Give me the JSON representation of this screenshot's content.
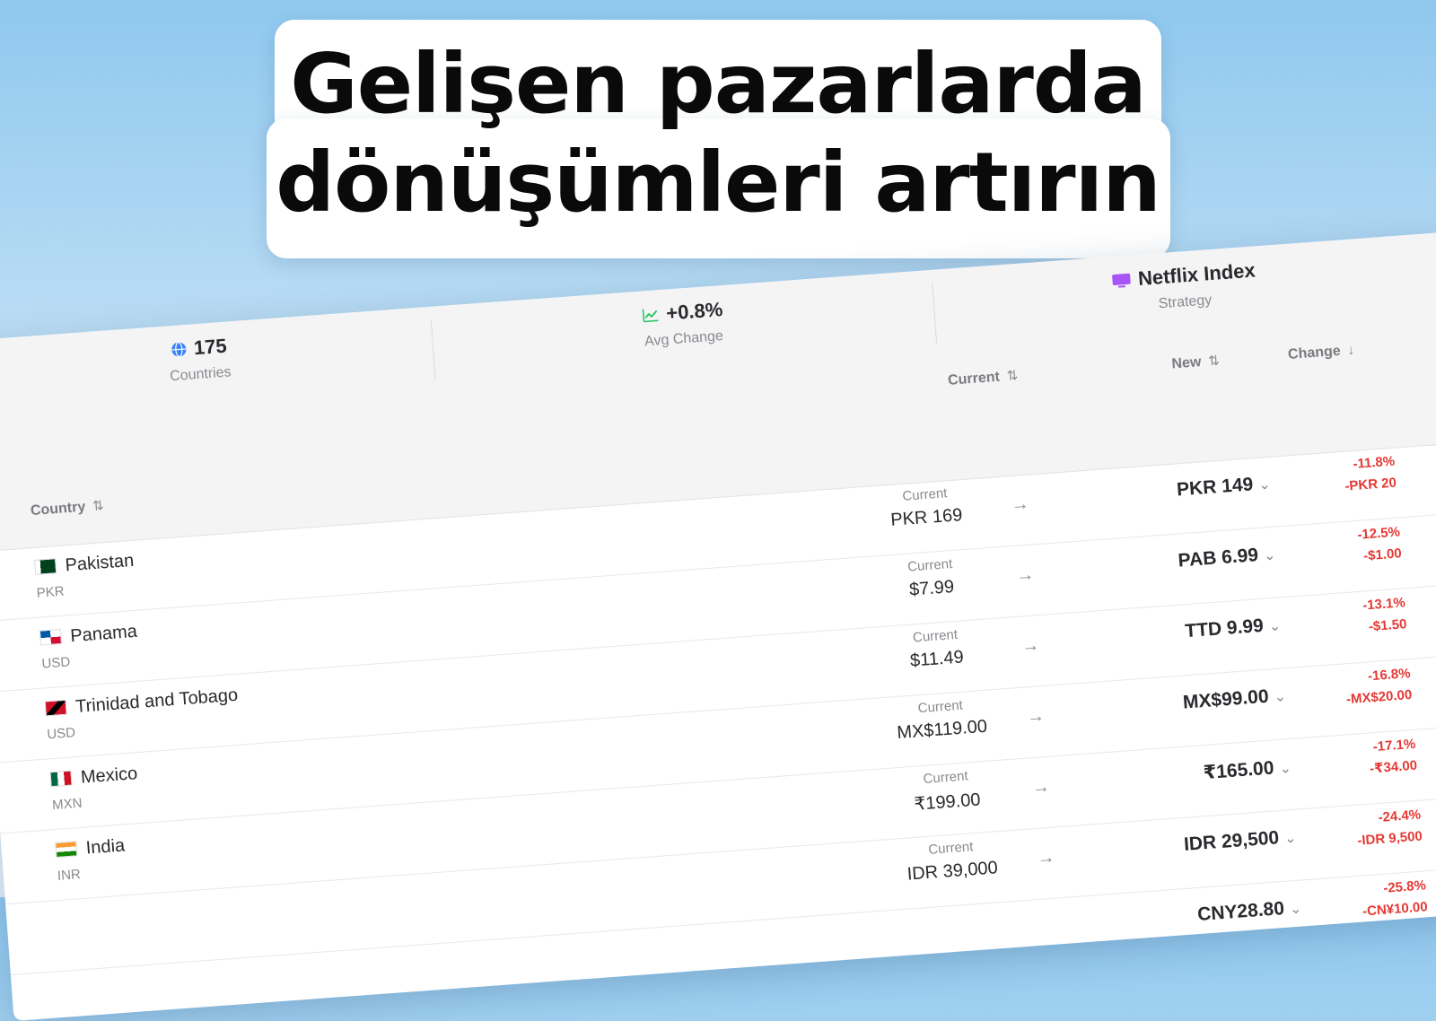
{
  "headline": {
    "line1": "Gelişen pazarlarda",
    "line2": "dönüşümleri artırın"
  },
  "stats": [
    {
      "value": "175",
      "label": "Countries",
      "icon": "globe-icon",
      "icon_color": "#3b82f6"
    },
    {
      "value": "+0.8%",
      "label": "Avg Change",
      "icon": "chart-line-icon",
      "icon_color": "#22c55e"
    },
    {
      "value": "Netflix Index",
      "label": "Strategy",
      "icon": "tv-icon",
      "icon_color": "#a855f7"
    }
  ],
  "columns": {
    "country": "Country",
    "current": "Current",
    "new": "New",
    "change": "Change"
  },
  "row_current_label": "Current",
  "rows": [
    {
      "country": "Pakistan",
      "currency": "PKR",
      "current": "PKR 169",
      "new": "PKR 149",
      "pct": "-11.8%",
      "diff": "-PKR 20"
    },
    {
      "country": "Panama",
      "currency": "USD",
      "current": "$7.99",
      "new": "PAB 6.99",
      "pct": "-12.5%",
      "diff": "-$1.00"
    },
    {
      "country": "Trinidad and Tobago",
      "currency": "USD",
      "current": "$11.49",
      "new": "TTD 9.99",
      "pct": "-13.1%",
      "diff": "-$1.50"
    },
    {
      "country": "Mexico",
      "currency": "MXN",
      "current": "MX$119.00",
      "new": "MX$99.00",
      "pct": "-16.8%",
      "diff": "-MX$20.00"
    },
    {
      "country": "India",
      "currency": "INR",
      "current": "₹199.00",
      "new": "₹165.00",
      "pct": "-17.1%",
      "diff": "-₹34.00"
    },
    {
      "country": "",
      "currency": "",
      "current": "IDR 39,000",
      "new": "IDR 29,500",
      "pct": "-24.4%",
      "diff": "-IDR 9,500"
    },
    {
      "country": "",
      "currency": "",
      "current": "",
      "new": "CNY28.80",
      "pct": "-25.8%",
      "diff": "-CN¥10.00"
    }
  ],
  "colors": {
    "negative": "#e53935",
    "text": "#2a2a2e",
    "muted": "#8a8a90"
  }
}
